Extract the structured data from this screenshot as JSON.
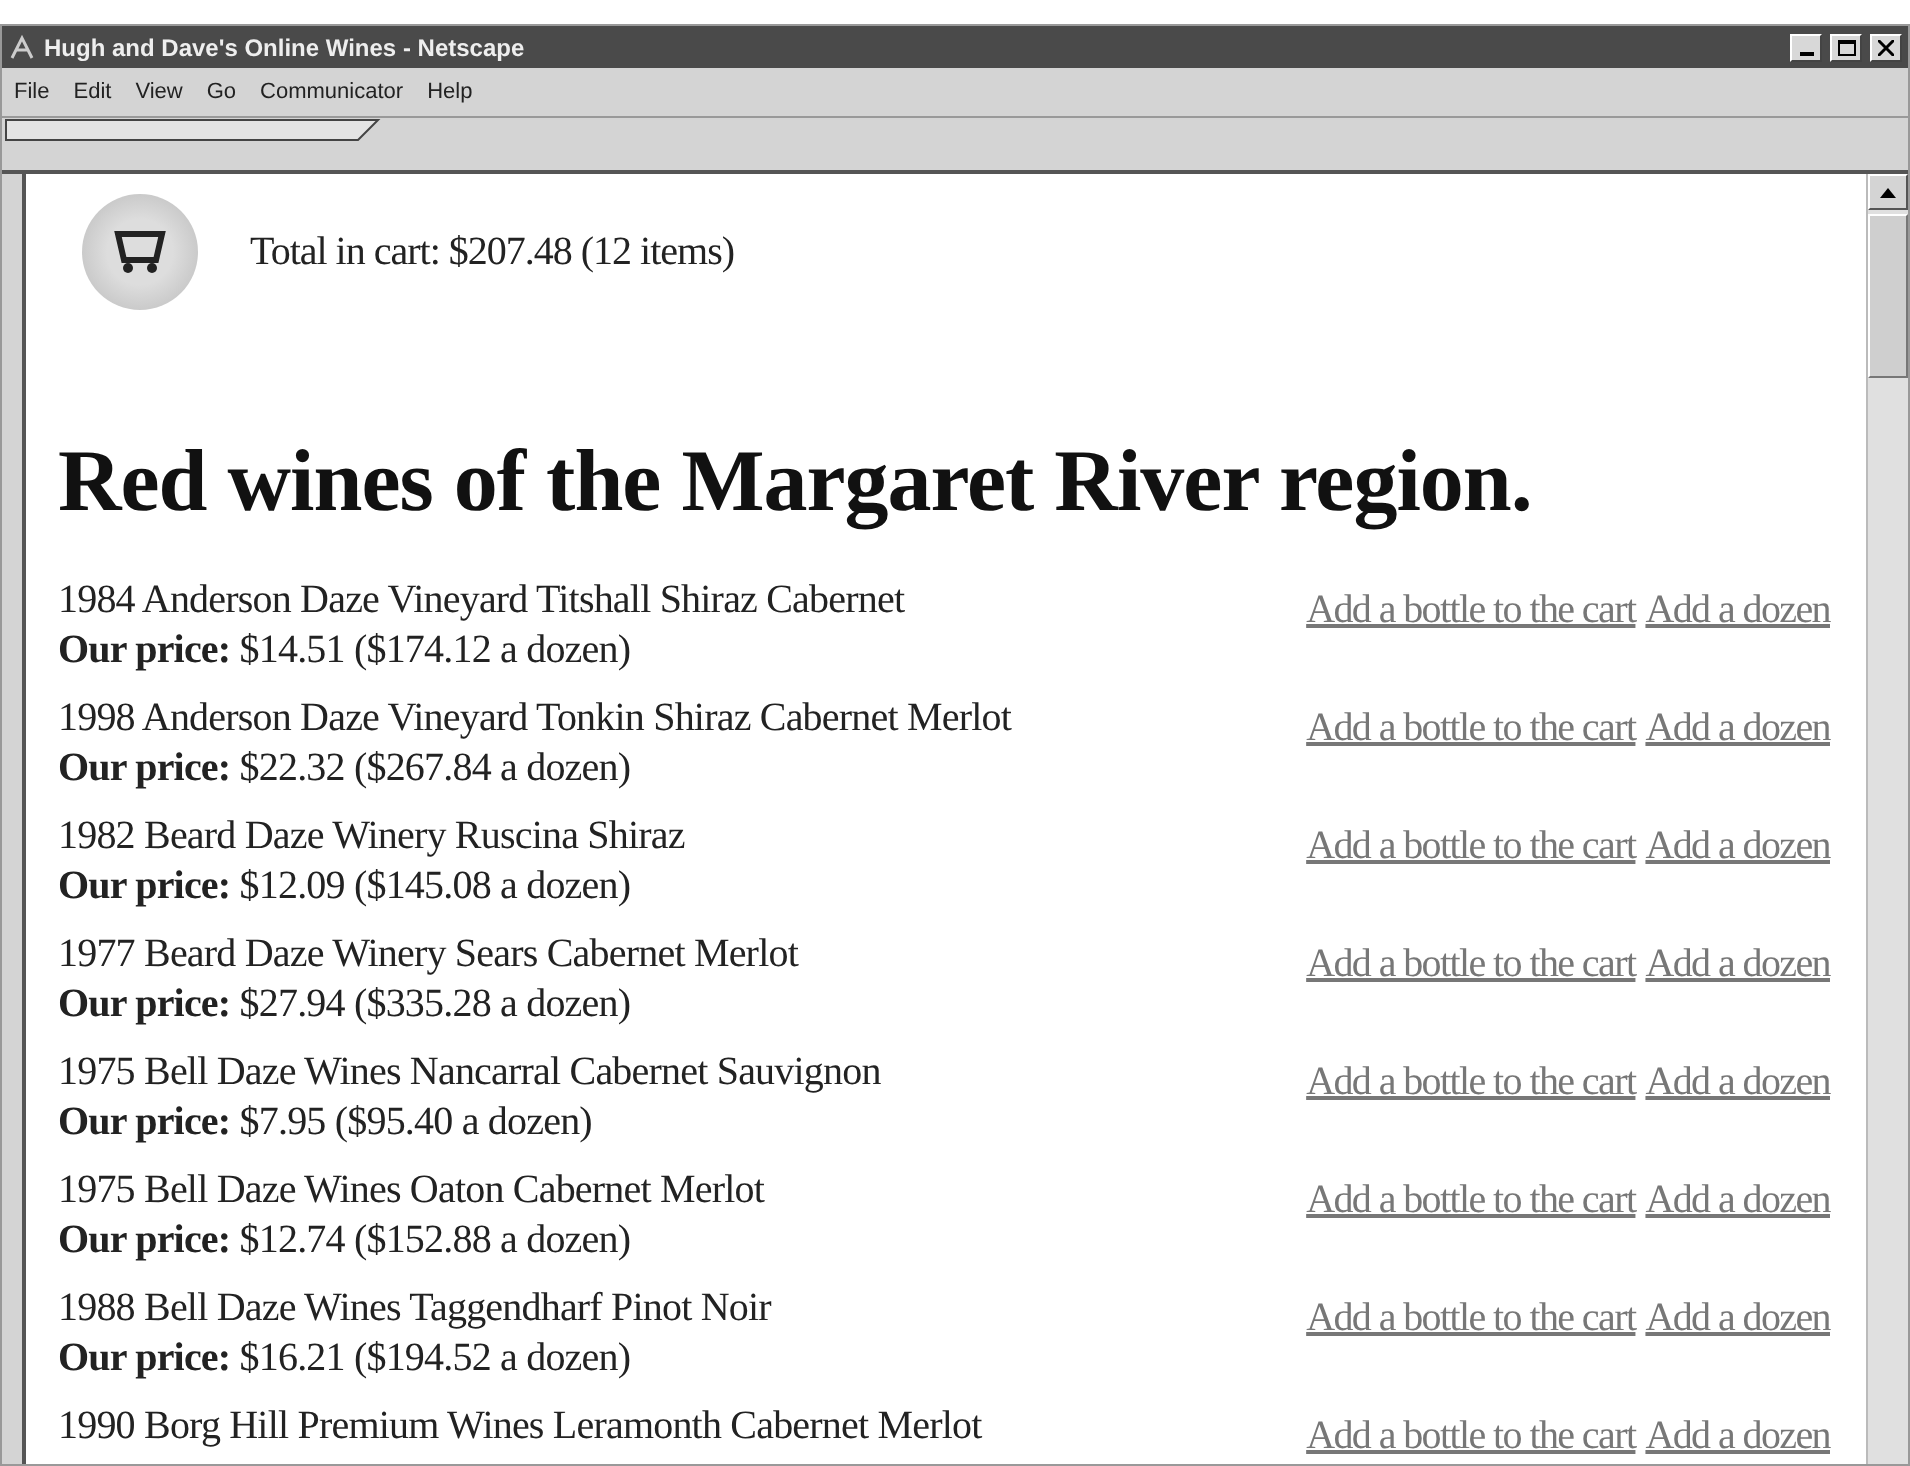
{
  "window": {
    "title": "Hugh and Dave's Online Wines - Netscape"
  },
  "menu": [
    "File",
    "Edit",
    "View",
    "Go",
    "Communicator",
    "Help"
  ],
  "cart": {
    "summary": "Total in cart: $207.48 (12 items)"
  },
  "heading": "Red wines of the Margaret River region.",
  "wines": [
    {
      "name": "1984 Anderson Daze Vineyard Titshall Shiraz Cabernet",
      "price": "**Our price:** $14.51 ($174.12 a dozen)",
      "links": [
        "Add a bottle to the cart",
        "Add a dozen"
      ]
    },
    {
      "name": "1998 Anderson Daze Vineyard Tonkin Shiraz Cabernet Merlot",
      "price": "**Our price:** $22.32 ($267.84 a dozen)",
      "links": [
        "Add a bottle to the cart",
        "Add a dozen"
      ]
    },
    {
      "name": "1982 Beard Daze Winery Ruscina Shiraz",
      "price": "**Our price:** $12.09 ($145.08 a dozen)",
      "links": [
        "Add a bottle to the cart",
        "Add a dozen"
      ]
    },
    {
      "name": "1977 Beard Daze Winery Sears Cabernet Merlot",
      "price": "**Our price:** $27.94 ($335.28 a dozen)",
      "links": [
        "Add a bottle to the cart",
        "Add a dozen"
      ]
    },
    {
      "name": "1975 Bell Daze Wines Nancarral Cabernet Sauvignon",
      "price": "**Our price:** $7.95 ($95.40 a dozen)",
      "links": [
        "Add a bottle to the cart",
        "Add a dozen"
      ]
    },
    {
      "name": "1975 Bell Daze Wines Oaton Cabernet Merlot",
      "price": "**Our price:** $12.74 ($152.88 a dozen)",
      "links": [
        "Add a bottle to the cart",
        "Add a dozen"
      ]
    },
    {
      "name": "1988 Bell Daze Wines Taggendharf Pinot Noir",
      "price": "**Our price:** $16.21 ($194.52 a dozen)",
      "links": [
        "Add a bottle to the cart",
        "Add a dozen"
      ]
    },
    {
      "name": "1990 Borg Hill Premium Wines Leramonth Cabernet Merlot",
      "links": [
        "Add a bottle to the cart",
        "Add a dozen"
      ]
    }
  ]
}
